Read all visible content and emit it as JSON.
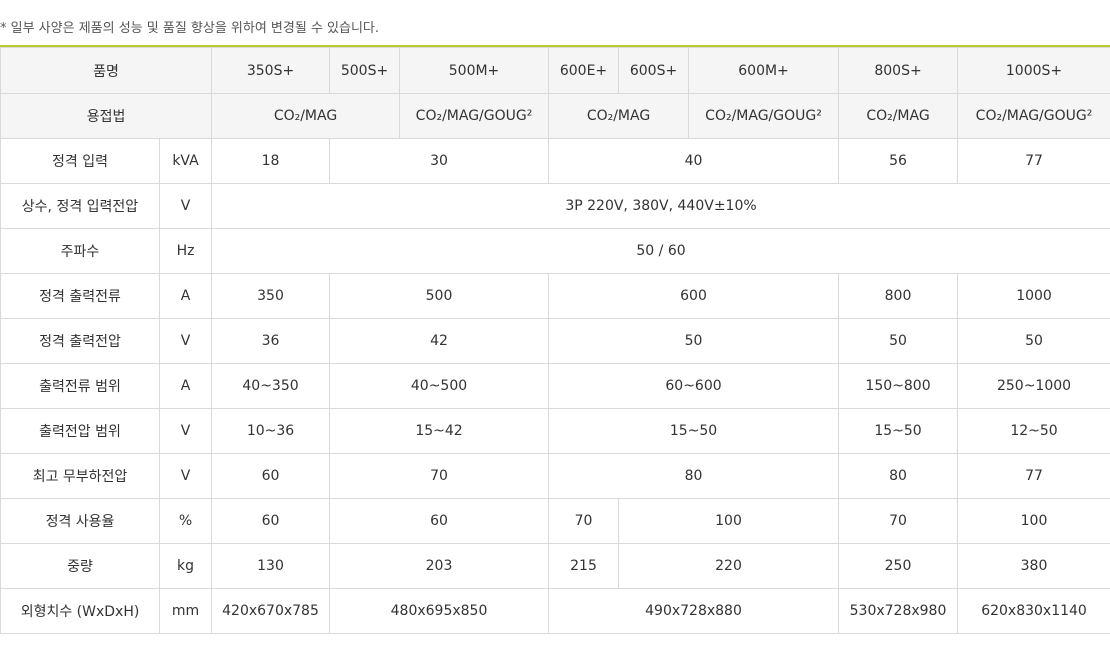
{
  "note": "* 일부 사양은 제품의 성능 및 품질 향상을 위하여 변경될 수 있습니다.",
  "header": {
    "product_label": "품명",
    "models": [
      "350S+",
      "500S+",
      "500M+",
      "600E+",
      "600S+",
      "600M+",
      "800S+",
      "1000S+"
    ],
    "process_label": "용접법",
    "processes": [
      "CO₂/MAG",
      "CO₂/MAG/GOUG²",
      "CO₂/MAG",
      "CO₂/MAG/GOUG²",
      "CO₂/MAG",
      "CO₂/MAG/GOUG²"
    ]
  },
  "rows": [
    {
      "label": "정격 입력",
      "unit": "kVA",
      "values": [
        "18",
        "30",
        "40",
        "56",
        "77"
      ]
    },
    {
      "label": "상수, 정격 입력전압",
      "unit": "V",
      "values": [
        "3P 220V, 380V, 440V±10%"
      ]
    },
    {
      "label": "주파수",
      "unit": "Hz",
      "values": [
        "50 / 60"
      ]
    },
    {
      "label": "정격 출력전류",
      "unit": "A",
      "values": [
        "350",
        "500",
        "600",
        "800",
        "1000"
      ]
    },
    {
      "label": "정격 출력전압",
      "unit": "V",
      "values": [
        "36",
        "42",
        "50",
        "50",
        "50"
      ]
    },
    {
      "label": "출력전류 범위",
      "unit": "A",
      "values": [
        "40~350",
        "40~500",
        "60~600",
        "150~800",
        "250~1000"
      ]
    },
    {
      "label": "출력전압 범위",
      "unit": "V",
      "values": [
        "10~36",
        "15~42",
        "15~50",
        "15~50",
        "12~50"
      ]
    },
    {
      "label": "최고 무부하전압",
      "unit": "V",
      "values": [
        "60",
        "70",
        "80",
        "80",
        "77"
      ]
    },
    {
      "label": "정격 사용율",
      "unit": "%",
      "values": [
        "60",
        "60",
        "70",
        "100",
        "70",
        "100"
      ]
    },
    {
      "label": "중량",
      "unit": "kg",
      "values": [
        "130",
        "203",
        "215",
        "220",
        "250",
        "380"
      ]
    },
    {
      "label": "외형치수 (WxDxH)",
      "unit": "mm",
      "values": [
        "420x670x785",
        "480x695x850",
        "490x728x880",
        "530x728x980",
        "620x830x1140"
      ]
    }
  ]
}
